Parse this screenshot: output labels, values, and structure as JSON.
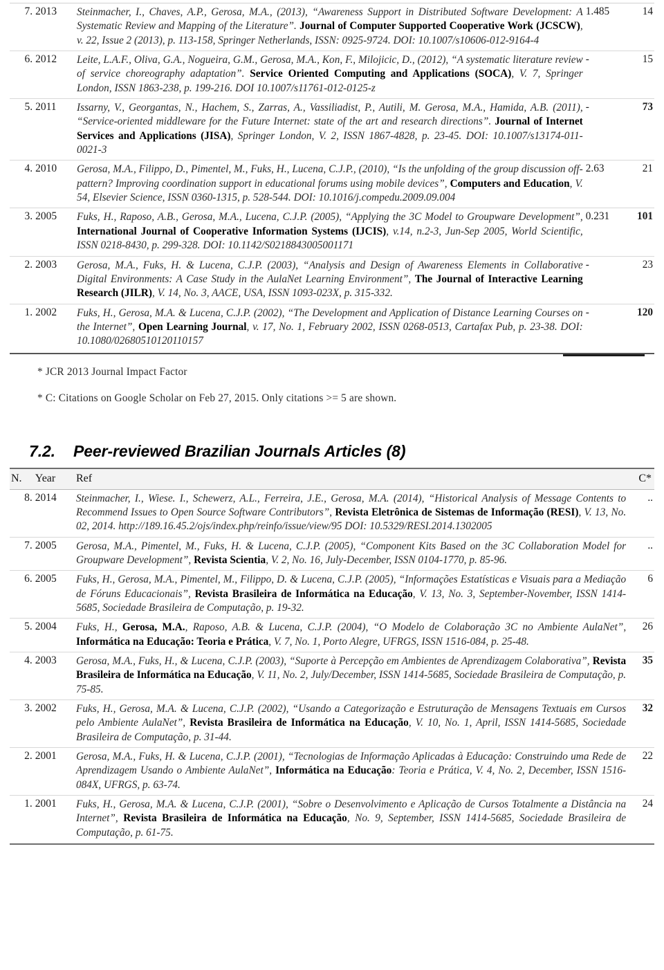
{
  "table1": {
    "rows": [
      {
        "num": "7.",
        "year": "2013",
        "ref_html": "Steinmacher, I., Chaves, A.P., Gerosa, M.A., (2013), “Awareness Support in Distributed Software Development: A Systematic Review and Mapping of the Literature”. <b>Journal of Computer Supported Cooperative Work (JCSCW)</b>, v. 22, Issue 2 (2013), p. 113-158, Springer Netherlands, ISSN: 0925-9724. DOI: 10.1007/s10606-012-9164-4",
        "impact_factor": "1.485",
        "citations": "14",
        "citations_bold": false
      },
      {
        "num": "6.",
        "year": "2012",
        "ref_html": "Leite, L.A.F., Oliva, G.A., Nogueira, G.M., Gerosa, M.A., Kon, F., Milojicic, D., (2012), “A systematic literature review of service choreography adaptation”. <b>Service Oriented Computing and Applications (SOCA)</b>, V. 7, Springer London, ISSN 1863-238, p. 199-216. DOI 10.1007/s11761-012-0125-z",
        "impact_factor": "-",
        "citations": "15",
        "citations_bold": false
      },
      {
        "num": "5.",
        "year": "2011",
        "ref_html": "Issarny, V., Georgantas, N., Hachem, S., Zarras, A., Vassiliadist, P., Autili, M. Gerosa, M.A., Hamida, A.B. (2011), “Service-oriented middleware for the Future Internet: state of the art and research directions”. <b>Journal of Internet Services and Applications (JISA)</b>, Springer London, V. 2, ISSN 1867-4828, p. 23-45. DOI: 10.1007/s13174-011-0021-3",
        "impact_factor": "-",
        "citations": "73",
        "citations_bold": true
      },
      {
        "num": "4.",
        "year": "2010",
        "ref_html": "Gerosa, M.A., Filippo, D., Pimentel, M., Fuks, H., Lucena, C.J.P., (2010), “Is the unfolding of the group discussion off-pattern? Improving coordination support in educational forums using mobile devices”, <b>Computers and Education</b>, V. 54, Elsevier Science, ISSN 0360-1315, p. 528-544. DOI: 10.1016/j.compedu.2009.09.004",
        "impact_factor": "2.63",
        "citations": "21",
        "citations_bold": false
      },
      {
        "num": "3.",
        "year": "2005",
        "ref_html": "Fuks, H., Raposo, A.B., Gerosa, M.A., Lucena, C.J.P. (2005), “Applying the 3C Model to Groupware Development”, <b>International Journal of Cooperative Information Systems (IJCIS)</b>, v.14, n.2-3, Jun-Sep 2005, World Scientific, ISSN 0218-8430, p. 299-328. DOI: 10.1142/S0218843005001171",
        "impact_factor": "0.231",
        "citations": "101",
        "citations_bold": true
      },
      {
        "num": "2.",
        "year": "2003",
        "ref_html": "Gerosa, M.A., Fuks, H. &amp; Lucena, C.J.P. (2003), “Analysis and Design of Awareness Elements in Collaborative Digital Environments: A Case Study in the AulaNet Learning Environment”, <b>The Journal of Interactive Learning Research (JILR)</b>, V. 14, No. 3, AACE, USA, ISSN 1093-023X, p. 315-332.",
        "impact_factor": "-",
        "citations": "23",
        "citations_bold": false
      },
      {
        "num": "1.",
        "year": "2002",
        "ref_html": "Fuks, H., Gerosa, M.A. &amp; Lucena, C.J.P. (2002), “The Development and Application of Distance Learning Courses on the Internet”, <b>Open Learning Journal</b>, v. 17, No. 1, February 2002, ISSN 0268-0513, Cartafax Pub, p. 23-38. DOI: 10.1080/02680510120110157",
        "impact_factor": "-",
        "citations": "120",
        "citations_bold": true
      }
    ]
  },
  "footnotes": {
    "impact_factor_note": "* JCR 2013 Journal Impact Factor",
    "citations_note": "* C: Citations on Google Scholar on Feb 27, 2015. Only citations >= 5 are shown."
  },
  "section": {
    "number": "7.2.",
    "title": "Peer-reviewed Brazilian Journals Articles (8)"
  },
  "table2": {
    "headers": {
      "num": "N.",
      "year": "Year",
      "ref": "Ref",
      "citations": "C*"
    },
    "rows": [
      {
        "num": "8.",
        "year": "2014",
        "ref_html": "Steinmacher, I., Wiese. I., Schewerz, A.L., Ferreira, J.E., Gerosa, M.A. (2014), “Historical Analysis of Message Contents to Recommend Issues to Open Source Software Contributors”, <b>Revista Eletrônica de Sistemas de Informação (RESI)</b>, V. 13, No. 02, 2014. http://189.16.45.2/ojs/index.php/reinfo/issue/view/95 DOI: 10.5329/RESI.2014.1302005",
        "citations": "..",
        "citations_bold": false
      },
      {
        "num": "7.",
        "year": "2005",
        "ref_html": "Gerosa, M.A., Pimentel, M., Fuks, H. &amp; Lucena, C.J.P. (2005), “Component Kits Based on the 3C Collaboration Model for Groupware Development”, <b>Revista Scientia</b>, V. 2, No. 16, July-December, ISSN 0104-1770, p. 85-96.",
        "citations": "..",
        "citations_bold": false
      },
      {
        "num": "6.",
        "year": "2005",
        "ref_html": "Fuks, H., Gerosa, M.A., Pimentel, M., Filippo, D. &amp; Lucena, C.J.P. (2005), “Informações Estatísticas e Visuais para a Mediação de Fóruns Educacionais”, <b>Revista Brasileira de Informática na Educação</b>, V. 13, No. 3, September-November, ISSN 1414-5685, Sociedade Brasileira de Computação, p. 19-32.",
        "citations": "6",
        "citations_bold": false
      },
      {
        "num": "5.",
        "year": "2004",
        "ref_html": "Fuks, H., <b>Gerosa, M.A.</b>, Raposo, A.B. &amp; Lucena, C.J.P. (2004), “O Modelo de Colaboração 3C no Ambiente AulaNet”, <b>Informática na Educação: Teoria e Prática</b>, V. 7, No. 1, Porto Alegre, UFRGS, ISSN 1516-084, p. 25-48.",
        "citations": "26",
        "citations_bold": false
      },
      {
        "num": "4.",
        "year": "2003",
        "ref_html": "Gerosa, M.A., Fuks, H., &amp; Lucena, C.J.P. (2003), “Suporte à Percepção em Ambientes de Aprendizagem Colaborativa”, <b>Revista Brasileira de Informática na Educação</b>, V. 11, No. 2, July/December, ISSN 1414-5685, Sociedade Brasileira de Computação, p. 75-85.",
        "citations": "35",
        "citations_bold": true
      },
      {
        "num": "3.",
        "year": "2002",
        "ref_html": "Fuks, H., Gerosa, M.A. &amp; Lucena, C.J.P. (2002), “Usando a Categorização e Estruturação de Mensagens Textuais em Cursos pelo Ambiente AulaNet”, <b>Revista Brasileira de Informática na Educação</b>, V. 10, No. 1, April, ISSN 1414-5685, Sociedade Brasileira de Computação, p. 31-44.",
        "citations": "32",
        "citations_bold": true
      },
      {
        "num": "2.",
        "year": "2001",
        "ref_html": "Gerosa, M.A., Fuks, H. &amp; Lucena, C.J.P. (2001), “Tecnologias de Informação Aplicadas à Educação: Construindo uma Rede de Aprendizagem Usando o Ambiente AulaNet”, <b>Informática na Educação</b>: Teoria e Prática, V. 4, No. 2, December, ISSN 1516-084X, UFRGS, p. 63-74.",
        "citations": "22",
        "citations_bold": false
      },
      {
        "num": "1.",
        "year": "2001",
        "ref_html": "Fuks, H., Gerosa, M.A. &amp; Lucena, C.J.P. (2001), “Sobre o Desenvolvimento e Aplicação de Cursos Totalmente a Distância na Internet”, <b>Revista Brasileira de Informática na Educação</b>, No. 9, September, ISSN 1414-5685, Sociedade Brasileira de Computação, p. 61-75.",
        "citations": "24",
        "citations_bold": false
      }
    ]
  }
}
